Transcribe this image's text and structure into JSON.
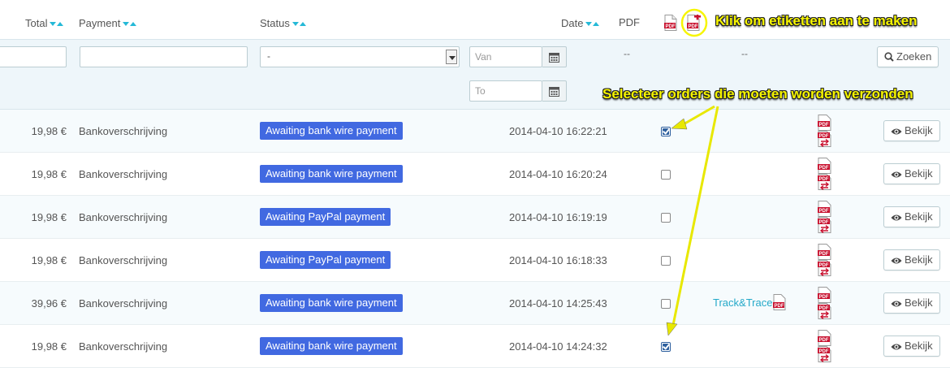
{
  "header": {
    "total": "Total",
    "payment": "Payment",
    "status": "Status",
    "date": "Date",
    "pdf": "PDF",
    "annotation_labels": "Klik om etiketten aan te maken"
  },
  "filters": {
    "total_value": "",
    "payment_value": "",
    "status_selected": "-",
    "date_from_placeholder": "Van",
    "date_to_placeholder": "To",
    "pdf_dash": "--",
    "labels_dash": "--",
    "search_label": "Zoeken"
  },
  "annotation_select": "Selecteer orders die moeten worden verzonden",
  "rows": [
    {
      "total": "19,98 €",
      "payment": "Bankoverschrijving",
      "status": "Awaiting bank wire payment",
      "date": "2014-04-10 16:22:21",
      "checked": true,
      "track": "",
      "action": "Bekijk"
    },
    {
      "total": "19,98 €",
      "payment": "Bankoverschrijving",
      "status": "Awaiting bank wire payment",
      "date": "2014-04-10 16:20:24",
      "checked": false,
      "track": "",
      "action": "Bekijk"
    },
    {
      "total": "19,98 €",
      "payment": "Bankoverschrijving",
      "status": "Awaiting PayPal payment",
      "date": "2014-04-10 16:19:19",
      "checked": false,
      "track": "",
      "action": "Bekijk"
    },
    {
      "total": "19,98 €",
      "payment": "Bankoverschrijving",
      "status": "Awaiting PayPal payment",
      "date": "2014-04-10 16:18:33",
      "checked": false,
      "track": "",
      "action": "Bekijk"
    },
    {
      "total": "39,96 €",
      "payment": "Bankoverschrijving",
      "status": "Awaiting bank wire payment",
      "date": "2014-04-10 14:25:43",
      "checked": false,
      "track": "Track&Trace",
      "action": "Bekijk"
    },
    {
      "total": "19,98 €",
      "payment": "Bankoverschrijving",
      "status": "Awaiting bank wire payment",
      "date": "2014-04-10 14:24:32",
      "checked": true,
      "track": "",
      "action": "Bekijk"
    }
  ],
  "colors": {
    "status_badge": "#4169e1",
    "sort_arrow": "#25b9d7",
    "annotation": "#f6f500",
    "link": "#25a9c9"
  },
  "icons": {
    "sort": "sort-arrows-icon",
    "calendar": "calendar-icon",
    "search": "search-icon",
    "view": "eye-icon",
    "pdf": "pdf-icon",
    "pdf_add": "pdf-add-icon",
    "pdf_return": "pdf-return-icon"
  }
}
